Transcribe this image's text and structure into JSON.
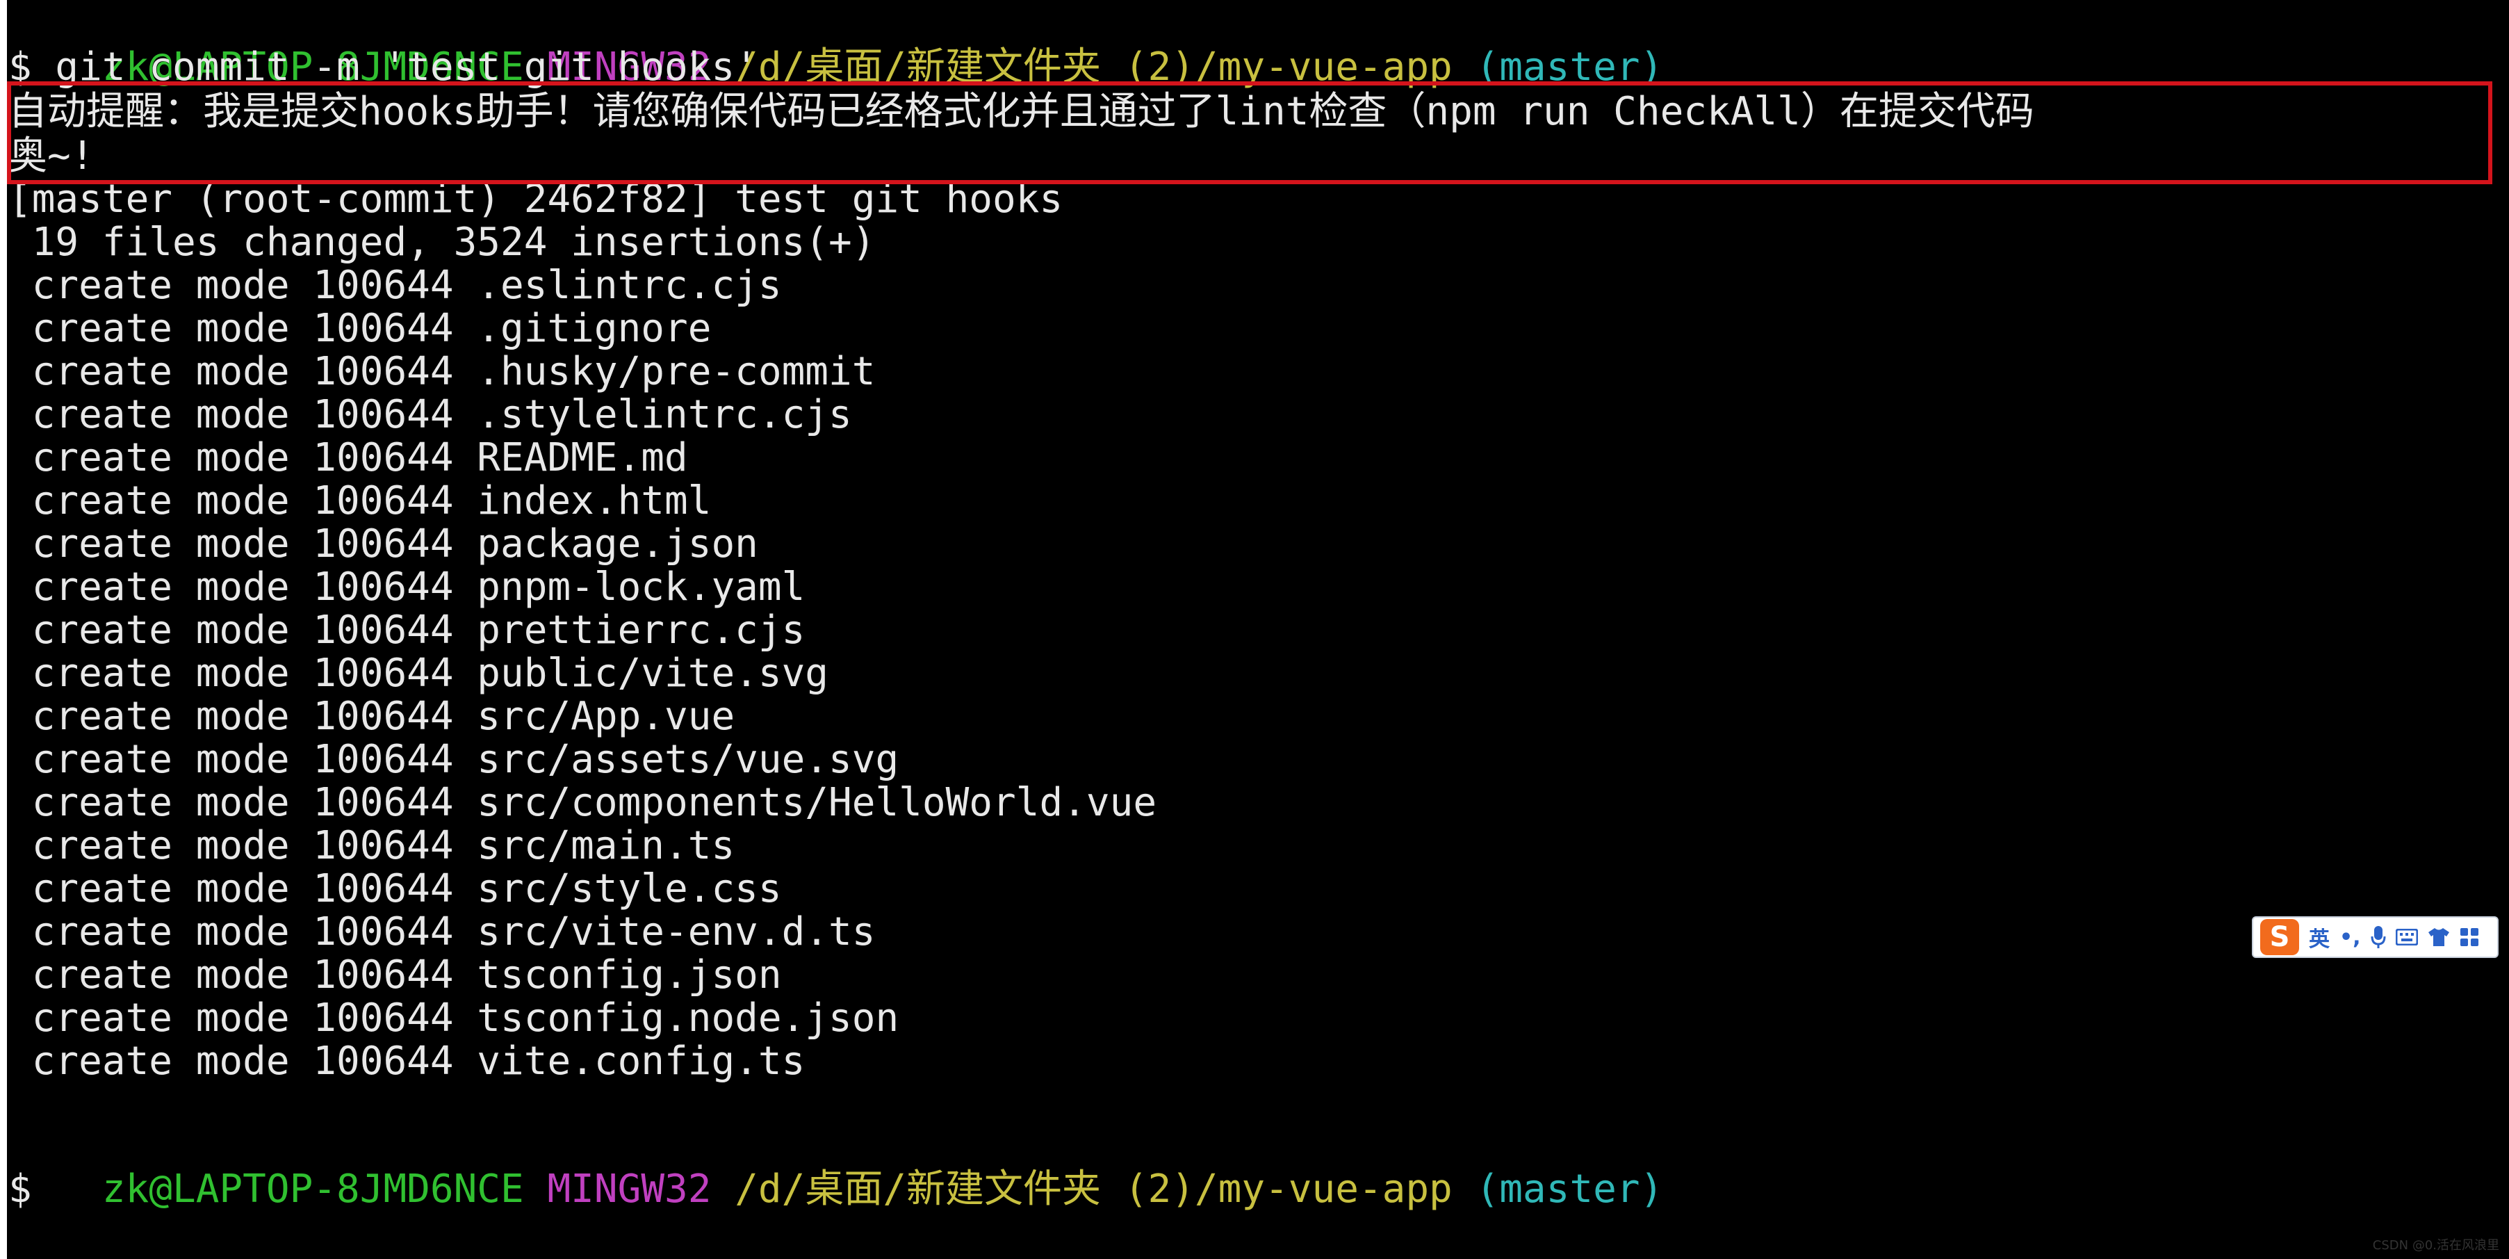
{
  "terminal": {
    "prompt1": {
      "user_host": "zk@LAPTOP-8JMD6NCE",
      "system": "MINGW32",
      "path": "/d/桌面/新建文件夹 (2)/my-vue-app",
      "branch": "(master)"
    },
    "command": "$ git commit -m 'test git hooks'",
    "hook_message_line1": "自动提醒：我是提交hooks助手！请您确保代码已经格式化并且通过了lint检查（npm run CheckAll）在提交代码",
    "hook_message_line2": "奥~!",
    "commit_summary": "[master (root-commit) 2462f82] test git hooks",
    "stats": " 19 files changed, 3524 insertions(+)",
    "mode_prefix": " create mode 100644 ",
    "files": [
      ".eslintrc.cjs",
      ".gitignore",
      ".husky/pre-commit",
      ".stylelintrc.cjs",
      "README.md",
      "index.html",
      "package.json",
      "pnpm-lock.yaml",
      "prettierrc.cjs",
      "public/vite.svg",
      "src/App.vue",
      "src/assets/vue.svg",
      "src/components/HelloWorld.vue",
      "src/main.ts",
      "src/style.css",
      "src/vite-env.d.ts",
      "tsconfig.json",
      "tsconfig.node.json",
      "vite.config.ts"
    ],
    "prompt2": {
      "user_host": "zk@LAPTOP-8JMD6NCE",
      "system": "MINGW32",
      "path": "/d/桌面/新建文件夹 (2)/my-vue-app",
      "branch": "(master)"
    },
    "final_prompt": "$"
  },
  "ime_toolbar": {
    "logo": "S",
    "mode": "英",
    "punct": "•,",
    "icons": [
      "microphone-icon",
      "keyboard-icon",
      "shirt-icon",
      "grid-icon"
    ]
  },
  "watermark": "CSDN @0.活在风浪里",
  "colors": {
    "user_host": "#30c030",
    "system": "#c040c0",
    "path": "#c8c040",
    "branch": "#30b8b8",
    "highlight": "#d4141c"
  }
}
